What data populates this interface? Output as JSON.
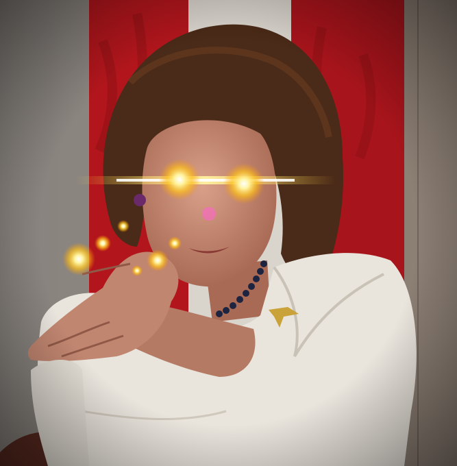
{
  "scene": {
    "kind": "photo-illustration",
    "subject": "person-clapping-with-glowing-eyes",
    "colors": {
      "flag_red": "#b2161c",
      "flag_white": "#d9d4cc",
      "wall": "#7f786f",
      "hair": "#4a2a18",
      "skin": "#c98e76",
      "jacket": "#e9e4dc",
      "glow": "#ffd23a",
      "necklace": "#1c2440"
    }
  }
}
